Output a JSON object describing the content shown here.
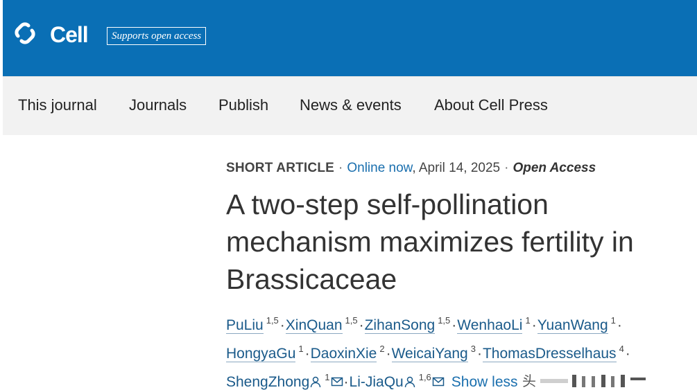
{
  "header": {
    "logo_text": "Cell",
    "logo_icon": "cell-logo-icon",
    "badge": "Supports open access",
    "bg_color": "#0a6fb5"
  },
  "nav": {
    "items": [
      "This journal",
      "Journals",
      "Publish",
      "News & events",
      "About Cell Press"
    ]
  },
  "article": {
    "type": "SHORT ARTICLE",
    "online": "Online now",
    "date": ", April 14, 2025",
    "access": "Open Access",
    "title": "A two-step self-pollination mechanism maximizes fertility in Brassicaceae",
    "authors": [
      {
        "name": "PuLiu",
        "sup": "1,5"
      },
      {
        "name": "XinQuan",
        "sup": "1,5"
      },
      {
        "name": "ZihanSong",
        "sup": "1,5"
      },
      {
        "name": "WenhaoLi",
        "sup": "1"
      },
      {
        "name": "YuanWang",
        "sup": "1"
      },
      {
        "name": "HongyaGu",
        "sup": "1"
      },
      {
        "name": "DaoxinXie",
        "sup": "2"
      },
      {
        "name": "WeicaiYang",
        "sup": "3"
      },
      {
        "name": "ThomasDresselhaus",
        "sup": "4"
      },
      {
        "name": "ShengZhong",
        "sup": "1"
      },
      {
        "name": "Li-JiaQu",
        "sup": "1,6"
      }
    ],
    "show_less": "Show less"
  }
}
